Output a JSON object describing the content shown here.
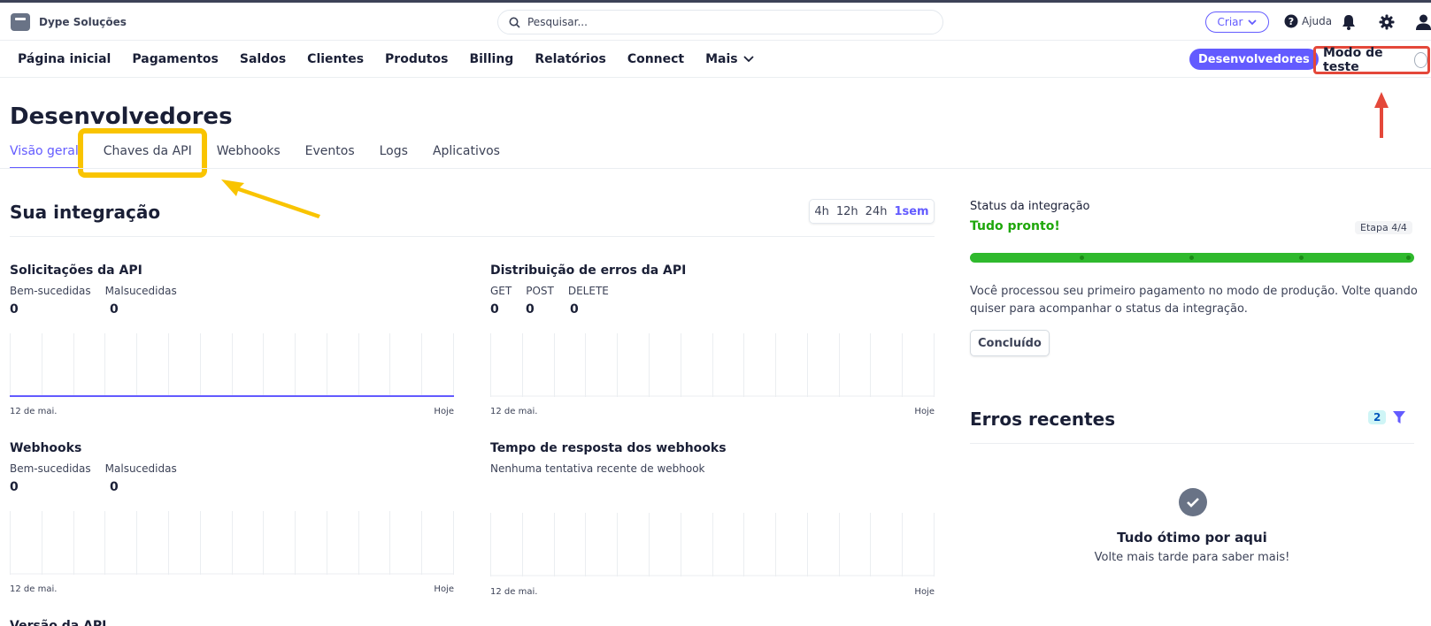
{
  "topbar": {
    "brand": "Dype Soluções",
    "search_placeholder": "Pesquisar...",
    "criar_label": "Criar",
    "ajuda_label": "Ajuda"
  },
  "nav": {
    "items": [
      "Página inicial",
      "Pagamentos",
      "Saldos",
      "Clientes",
      "Produtos",
      "Billing",
      "Relatórios",
      "Connect"
    ],
    "mais_label": "Mais",
    "developers_label": "Desenvolvedores",
    "test_mode_label": "Modo de teste",
    "test_mode_on": false
  },
  "page": {
    "title": "Desenvolvedores",
    "tabs": [
      {
        "label": "Visão geral",
        "active": true
      },
      {
        "label": "Chaves da API",
        "active": false
      },
      {
        "label": "Webhooks",
        "active": false
      },
      {
        "label": "Eventos",
        "active": false
      },
      {
        "label": "Logs",
        "active": false
      },
      {
        "label": "Aplicativos",
        "active": false
      }
    ]
  },
  "integration": {
    "title": "Sua integração",
    "time_filters": [
      "4h",
      "12h",
      "24h",
      "1sem"
    ],
    "time_filter_selected": "1sem",
    "api_requests": {
      "title": "Solicitações da API",
      "labels": [
        "Bem-sucedidas",
        "Malsucedidas"
      ],
      "values": [
        "0",
        "0"
      ],
      "start": "12 de mai.",
      "end": "Hoje"
    },
    "api_errors": {
      "title": "Distribuição de erros da API",
      "labels": [
        "GET",
        "POST",
        "DELETE"
      ],
      "values": [
        "0",
        "0",
        "0"
      ],
      "start": "12 de mai.",
      "end": "Hoje"
    },
    "webhooks": {
      "title": "Webhooks",
      "labels": [
        "Bem-sucedidas",
        "Malsucedidas"
      ],
      "values": [
        "0",
        "0"
      ],
      "start": "12 de mai.",
      "end": "Hoje"
    },
    "webhook_response": {
      "title": "Tempo de resposta dos webhooks",
      "subtitle": "Nenhuma tentativa recente de webhook",
      "start": "12 de mai.",
      "end": "Hoje"
    },
    "next_section_partial": "Versão da API"
  },
  "status": {
    "label": "Status da integração",
    "state": "Tudo pronto!",
    "step": "Etapa 4/4",
    "progress": 1.0,
    "text": "Você processou seu primeiro pagamento no modo de produção. Volte quando quiser para acompanhar o status da integração.",
    "done_button": "Concluído"
  },
  "recent_errors": {
    "title": "Erros recentes",
    "count": "2",
    "empty_title": "Tudo ótimo por aqui",
    "empty_sub": "Volte mais tarde para saber mais!"
  },
  "colors": {
    "accent": "#635bff",
    "success": "#1ea70a",
    "annotation_red": "#e4483a",
    "annotation_yellow": "#f9c400"
  }
}
